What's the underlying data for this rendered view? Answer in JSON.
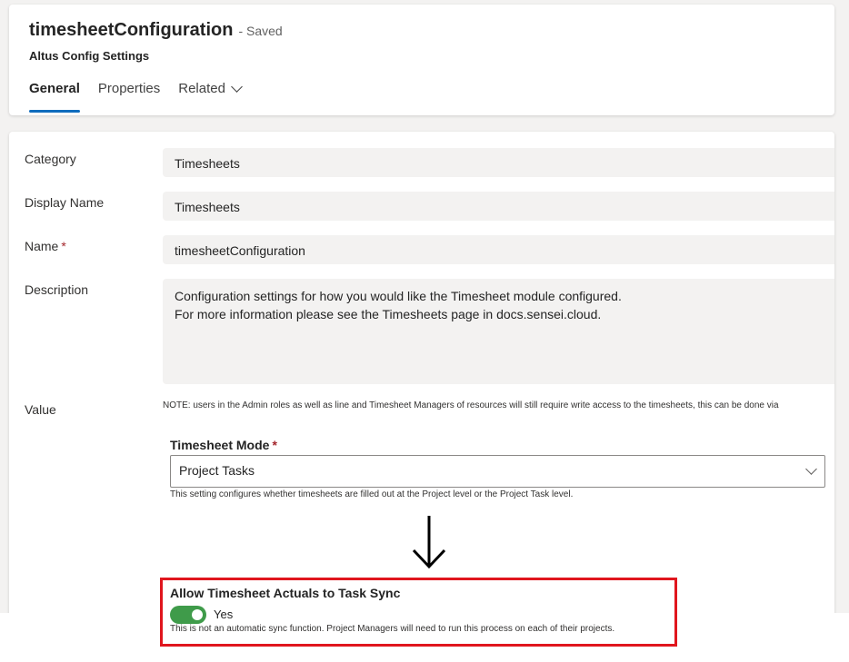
{
  "header": {
    "title": "timesheetConfiguration",
    "status": "- Saved",
    "entity": "Altus Config Settings",
    "tabs": [
      {
        "label": "General"
      },
      {
        "label": "Properties"
      },
      {
        "label": "Related"
      }
    ]
  },
  "form": {
    "category": {
      "label": "Category",
      "value": "Timesheets"
    },
    "display_name": {
      "label": "Display Name",
      "value": "Timesheets"
    },
    "name": {
      "label": "Name",
      "required_marker": "*",
      "value": "timesheetConfiguration"
    },
    "description": {
      "label": "Description",
      "line1": "Configuration settings for how you would like the Timesheet module configured.",
      "line2": "For more information please see the Timesheets page in docs.sensei.cloud."
    },
    "value": {
      "label": "Value",
      "note": "NOTE: users in the Admin roles as well as line and Timesheet Managers of resources will still require write access to the timesheets, this can be done via"
    }
  },
  "timesheet_mode": {
    "label": "Timesheet Mode",
    "required_marker": "*",
    "selected": "Project Tasks",
    "help": "This setting configures whether timesheets are filled out at the Project level or the Project Task level."
  },
  "sync": {
    "label": "Allow Timesheet Actuals to Task Sync",
    "toggle_on": true,
    "toggle_text": "Yes",
    "help": "This is not an automatic sync function. Project Managers will need to run this process on each of their projects."
  },
  "colors": {
    "accent": "#0f6cbd",
    "toggle_on": "#3f9b4a",
    "highlight": "#e0161e",
    "required": "#a4262c"
  }
}
